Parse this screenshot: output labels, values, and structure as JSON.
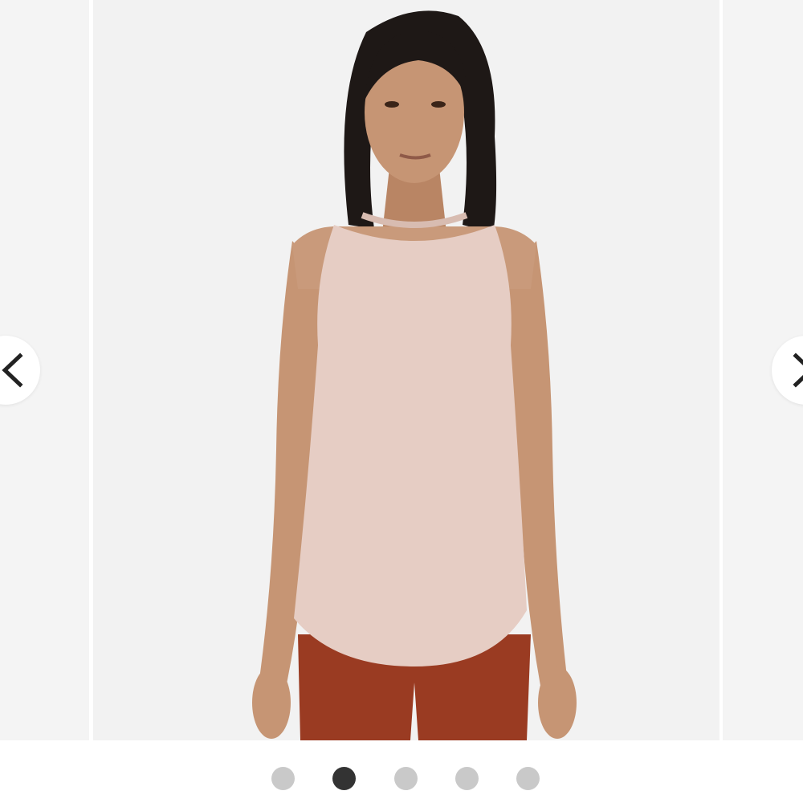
{
  "carousel": {
    "slide_count": 5,
    "active_index": 1,
    "prev_button": {
      "icon": "chevron-left-icon"
    },
    "next_button": {
      "icon": "chevron-right-icon"
    },
    "current_slide": {
      "image": "product-photo-woman-wearing-sleeveless-tank-top",
      "colors": {
        "background": "#f2f2f2",
        "tank_top": "#e6cdc4",
        "leggings": "#9a3b22",
        "hair": "#1e1816",
        "skin": "#c69574"
      }
    }
  },
  "colors": {
    "dot_inactive": "#c9c9c9",
    "dot_active": "#333333",
    "arrow_background": "#ffffff",
    "arrow_icon": "#222222"
  }
}
